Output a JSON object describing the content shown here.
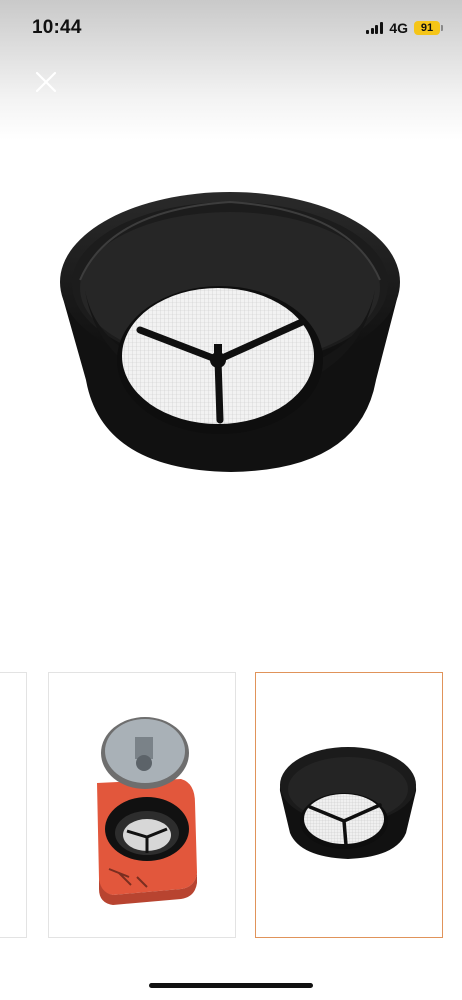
{
  "status_bar": {
    "time": "10:44",
    "network": "4G",
    "battery": "91",
    "battery_color": "#f5c518"
  },
  "viewer": {
    "close_icon": "close-icon",
    "main_image": "mesh-filter-basket-image",
    "thumbnails": [
      {
        "name": "thumbnail-partial",
        "selected": false
      },
      {
        "name": "thumbnail-appliance-open-lid",
        "selected": false
      },
      {
        "name": "thumbnail-filter-basket",
        "selected": true
      }
    ],
    "selected_border_color": "#e0935a"
  }
}
